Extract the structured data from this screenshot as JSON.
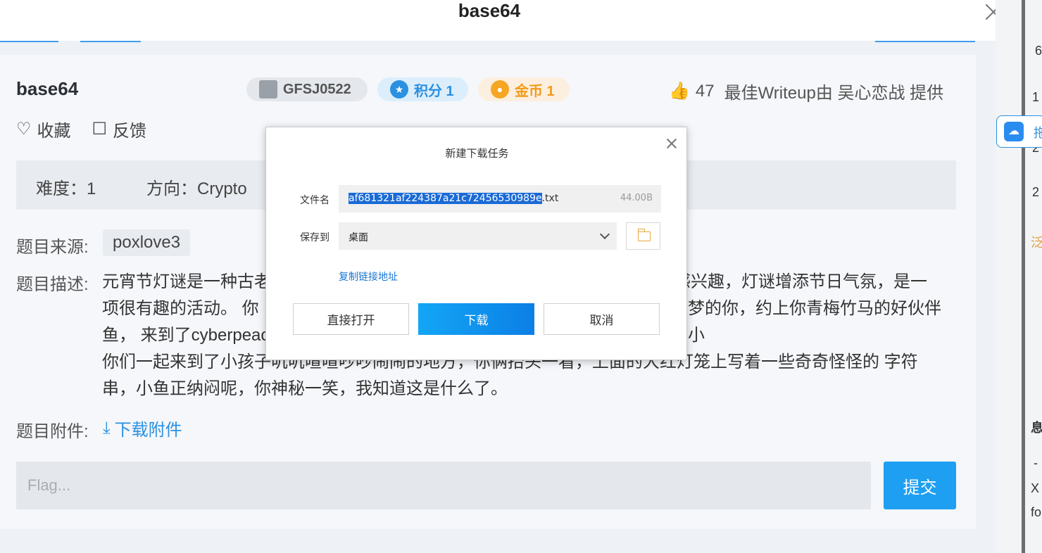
{
  "header": {
    "title": "base64"
  },
  "challenge": {
    "title": "base64",
    "id_tag": "GFSJ0522",
    "score_label": "积分 1",
    "coin_label": "金币 1",
    "likes_count": "47",
    "writeup_credit": "最佳Writeup由 吴心恋战 提供",
    "favorite_label": "收藏",
    "feedback_label": "反馈",
    "difficulty": "难度：1",
    "direction": "方向：Crypto",
    "source_label": "题目来源:",
    "source_value": "poxlove3",
    "description_label": "题目描述:",
    "description_lines": [
      "元宵节灯谜是一种古老",
      "感兴趣，灯谜增添节日气氛，是一",
      "项很有趣的活动。 你",
      "梦的你，约上你青梅竹马的好伙伴小",
      "鱼， 来到了cyberpeac",
      "你们一起来到了小孩子叽叽喳喳吵吵闹闹的地方，你俩抬头一看，上面的大红灯笼上写着一些奇奇怪怪的 字符",
      "串，小鱼正纳闷呢，你神秘一笑，我知道这是什么了。"
    ],
    "attachment_label": "题目附件:",
    "attachment_link": "下载附件",
    "flag_placeholder": "Flag...",
    "submit_label": "提交"
  },
  "download_dialog": {
    "title": "新建下载任务",
    "filename_label": "文件名",
    "filename_selected": "af681321af224387a21c72456530989e",
    "filename_ext": ".txt",
    "file_size": "44.00B",
    "save_to_label": "保存到",
    "save_to_value": "桌面",
    "copy_link_label": "复制链接地址",
    "open_label": "直接打开",
    "download_label": "下载",
    "cancel_label": "取消"
  },
  "right_strip": {
    "cloud_label": "拖",
    "fragments": [
      "6",
      "1",
      "2",
      "2",
      "泛",
      "息",
      "-",
      "X",
      "fo"
    ]
  },
  "colors": {
    "accent": "#1e9ff2",
    "link": "#2b90e0",
    "coin": "#f29b17",
    "selection": "#1a6ad6"
  }
}
